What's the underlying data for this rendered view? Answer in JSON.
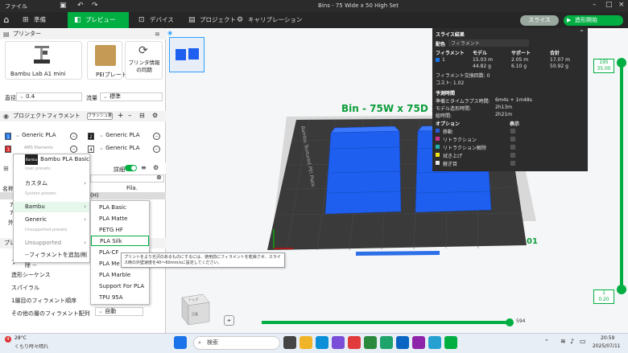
{
  "titlebar": {
    "menu": "ファイル",
    "title": "Bins - 75 Wide x 50 High Set"
  },
  "tabs": [
    {
      "label": "準備",
      "icon": "folder-icon"
    },
    {
      "label": "プレビュー",
      "icon": "preview-icon"
    },
    {
      "label": "デバイス",
      "icon": "device-icon"
    },
    {
      "label": "プロジェクト",
      "icon": "project-icon"
    },
    {
      "label": "キャリブレーション",
      "icon": "calibration-icon"
    }
  ],
  "buttons": {
    "slice": "スライス",
    "print": "造形開始"
  },
  "left": {
    "printer_header": "プリンター",
    "printer_name": "Bambu Lab A1 mini",
    "plate_name": "PEIプレート",
    "sync_label": "プリンタ情報の同期",
    "nozzle_label": "直径",
    "nozzle_value": "0.4",
    "flow_label": "流量",
    "flow_value": "標準",
    "filament_header": "プロジェクトフィラメント",
    "flush_label": "フラッシュ量",
    "filaments": [
      {
        "num": "1",
        "name": "Generic PLA",
        "color": "#1a73e8"
      },
      {
        "num": "2",
        "name": "Generic PLA",
        "color": "#111111"
      },
      {
        "num": "3",
        "name": "Generic PLA",
        "color": "#d32020"
      },
      {
        "num": "4",
        "name": "Generic PLA",
        "color": "#ffffff"
      }
    ],
    "ams_label": "AMS filaments",
    "detail_label": "詳細",
    "col_name": "名称",
    "col_fila": "Fila.",
    "obj_label": "(H)",
    "rows": [
      "75",
      "75",
      "外付"
    ],
    "process_label": "プレー",
    "process_rows": [
      {
        "label": "プ"
      },
      {
        "label": "造形シーケンス"
      },
      {
        "label": "スパイラル"
      },
      {
        "label": "1層目のフィラメント順序"
      },
      {
        "label": "その他の層のフィラメント配列",
        "value": "自動"
      }
    ]
  },
  "menu1": {
    "items": [
      {
        "type": "item",
        "label": "Bambu PLA Basic",
        "badge": "Bambu"
      },
      {
        "type": "hdr",
        "label": "User presets"
      },
      {
        "type": "item",
        "label": "カスタム",
        "arrow": true
      },
      {
        "type": "hdr",
        "label": "System presets"
      },
      {
        "type": "item",
        "label": "Bambu",
        "arrow": true,
        "sel": true
      },
      {
        "type": "item",
        "label": "Generic",
        "arrow": true
      },
      {
        "type": "hdr",
        "label": "Unsupported presets"
      },
      {
        "type": "item",
        "label": "Unsupported",
        "arrow": true
      },
      {
        "type": "item",
        "label": "--フィラメントを追加/削除 --",
        "arrow": true
      }
    ]
  },
  "menu2": {
    "items": [
      "PLA Basic",
      "PLA Matte",
      "PETG HF",
      "PLA Silk",
      "PLA-CF",
      "PLA Me",
      "PLA Marble",
      "Support For PLA",
      "TPU 95A"
    ]
  },
  "tooltip": "プリントをより光沢のあるものにするには、使用前にフィラメントを乾燥させ、スライス時の外壁速度を40～60mm/sに設定してください。",
  "plate_label": "Bin - 75W x 75D x 50H",
  "plate_side_label": "Bambu Textured PEI Plate",
  "plate_number": "01",
  "stats": {
    "title": "スライス結果",
    "layout_label": "配色",
    "layout_value": "フィラメント",
    "cols": [
      "フィラメント",
      "モデル",
      "サポート",
      "合計"
    ],
    "row1": [
      "1",
      "15.03 m",
      "2.05 m",
      "17.07 m"
    ],
    "row2": [
      "",
      "44.82 g",
      "6.10 g",
      "50.92 g"
    ],
    "swap": "フィラメント交換回数:  0",
    "cost": "コスト:  1.02",
    "time_hdr": "予測時間",
    "prep": "準備とタイムラプス時間:",
    "prep_v": "6m4s + 1m48s",
    "model_time": "モデル造形時間:",
    "model_time_v": "2h13m",
    "total": "総時間:",
    "total_v": "2h21m",
    "opt_hdr": "オプション",
    "show_hdr": "表示",
    "options": [
      {
        "label": "移動",
        "color": "#2a5bd7"
      },
      {
        "label": "リトラクション",
        "color": "#d0308a"
      },
      {
        "label": "リトラクション解除",
        "color": "#20b2aa"
      },
      {
        "label": "拭き上げ",
        "color": "#f2e318"
      },
      {
        "label": "継ぎ目",
        "color": "#e8e8e8"
      }
    ]
  },
  "vslider": {
    "top_line1": "195",
    "top_line2": "35.00",
    "bottom_line1": "1",
    "bottom_line2": "0.20"
  },
  "hslider": {
    "value": "594"
  },
  "viewcube": {
    "top": "トップ",
    "front": "正面"
  },
  "taskbar": {
    "temp": "28°C",
    "weather": "くもり時々晴れ",
    "search": "検索",
    "time": "20:59",
    "date": "2025/07/11"
  }
}
